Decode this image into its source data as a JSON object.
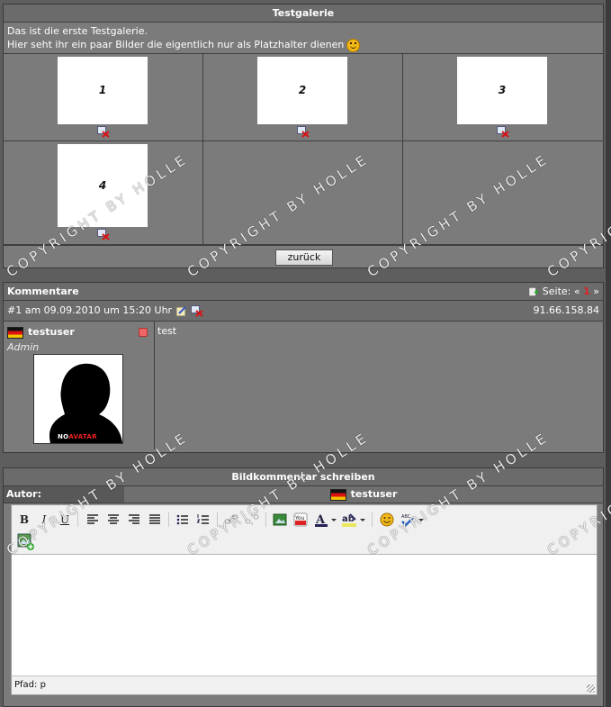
{
  "gallery": {
    "title": "Testgalerie",
    "desc_line1": "Das ist die erste Testgalerie.",
    "desc_line2": "Hier seht ihr ein paar Bilder die eigentlich nur als Platzhalter dienen",
    "thumbs": [
      "1",
      "2",
      "3",
      "4"
    ],
    "back_label": "zurück"
  },
  "comments": {
    "title": "Kommentare",
    "pager_label": "Seite:",
    "prev": "«",
    "page": "1",
    "next": "»",
    "entry": {
      "header": "#1 am 09.09.2010 um 15:20 Uhr",
      "ip": "91.66.158.84",
      "username": "testuser",
      "role": "Admin",
      "avatar_text_a": "NO",
      "avatar_text_b": "AVATAR",
      "text": "test"
    }
  },
  "write": {
    "title": "Bildkommentar schreiben",
    "author_label": "Autor:",
    "author_value": "testuser",
    "path_label": "Pfad: p"
  },
  "watermark": "COPYRIGHT BY HOLLE"
}
